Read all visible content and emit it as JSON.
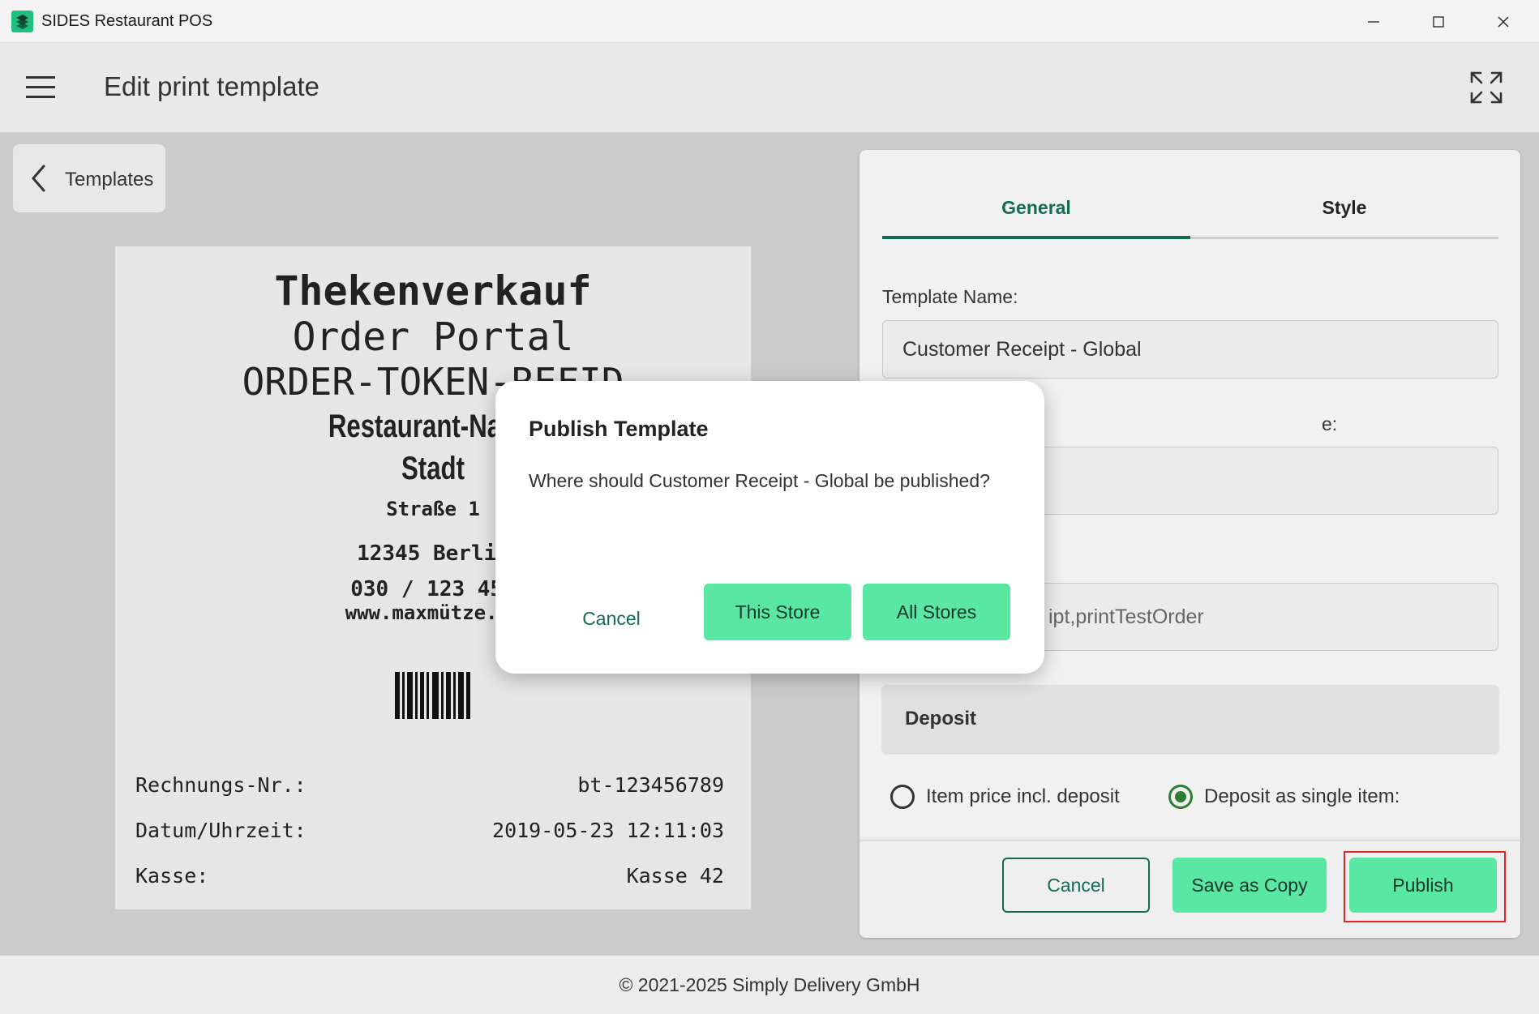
{
  "window": {
    "title": "SIDES Restaurant POS"
  },
  "header": {
    "title": "Edit print template"
  },
  "back": {
    "label": "Templates"
  },
  "receipt": {
    "line1": "Thekenverkauf",
    "line2": "Order Portal",
    "line3": "ORDER-TOKEN-REFID",
    "restaurant": "Restaurant-Name",
    "city": "Stadt",
    "street": "Straße 1",
    "zip_city": "12345 Berlin",
    "phone": "030 / 123 456",
    "website": "www.maxmütze.de",
    "rows": [
      {
        "label": "Rechnungs-Nr.:",
        "value": "bt-123456789"
      },
      {
        "label": "Datum/Uhrzeit:",
        "value": "2019-05-23 12:11:03"
      },
      {
        "label": "Kasse:",
        "value": "Kasse 42"
      }
    ]
  },
  "panel": {
    "tabs": [
      "General",
      "Style"
    ],
    "active_tab": "General",
    "template_name_label": "Template Name:",
    "template_name_value": "Customer Receipt - Global",
    "field2_label": "e:",
    "field2_value": "",
    "field3_value": "ipt,printTestOrder",
    "section_title": "Deposit",
    "radio_options": [
      {
        "label": "Item price incl. deposit",
        "checked": false
      },
      {
        "label": "Deposit as single item:",
        "checked": true
      }
    ],
    "buttons": {
      "cancel": "Cancel",
      "save_copy": "Save as Copy",
      "publish": "Publish"
    }
  },
  "dialog": {
    "title": "Publish Template",
    "message": "Where should Customer Receipt - Global be published?",
    "cancel": "Cancel",
    "this_store": "This Store",
    "all_stores": "All Stores"
  },
  "footer": {
    "text": "© 2021-2025 Simply Delivery GmbH"
  },
  "colors": {
    "accent": "#136a55",
    "button_fill": "#5ae6a3",
    "highlight": "#e0261e"
  }
}
